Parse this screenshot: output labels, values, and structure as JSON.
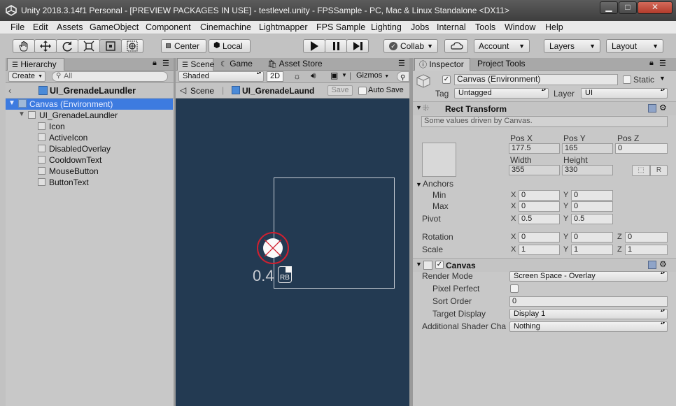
{
  "window": {
    "title": "Unity 2018.3.14f1 Personal - [PREVIEW PACKAGES IN USE] - testlevel.unity - FPSSample - PC, Mac & Linux Standalone <DX11>",
    "minimize": "▁",
    "maximize": "□",
    "close": "✕"
  },
  "menu": [
    "File",
    "Edit",
    "Assets",
    "GameObject",
    "Component",
    "Cinemachine",
    "Lightmapper",
    "FPS Sample",
    "Lighting",
    "Jobs",
    "Internal",
    "Tools",
    "Window",
    "Help"
  ],
  "toolbar": {
    "tools": [
      "hand-tool",
      "move-tool",
      "rotate-tool",
      "scale-tool",
      "rect-tool",
      "transform-tool"
    ],
    "pivot": "Center",
    "space": "Local",
    "collab": "Collab",
    "account": "Account",
    "layers": "Layers",
    "layout": "Layout"
  },
  "hierarchy": {
    "tab": "Hierarchy",
    "create": "Create",
    "search_placeholder": "All",
    "breadcrumb": "UI_GrenadeLaundler",
    "items": [
      {
        "label": "Canvas (Environment)",
        "depth": 0,
        "selected": true
      },
      {
        "label": "UI_GrenadeLaundler",
        "depth": 1
      },
      {
        "label": "Icon",
        "depth": 2
      },
      {
        "label": "ActiveIcon",
        "depth": 2
      },
      {
        "label": "DisabledOverlay",
        "depth": 2
      },
      {
        "label": "CooldownText",
        "depth": 2
      },
      {
        "label": "MouseButton",
        "depth": 2
      },
      {
        "label": "ButtonText",
        "depth": 2
      }
    ]
  },
  "scene": {
    "tabs": [
      "Scene",
      "Game",
      "Asset Store"
    ],
    "shading": "Shaded",
    "mode2d": "2D",
    "gizmos": "Gizmos",
    "breadcrumb_root": "Scene",
    "breadcrumb_prefab": "UI_GrenadeLaund",
    "save": "Save",
    "autosave": "Auto Save",
    "cooldown_text": "0.4",
    "button_text": "RB",
    "bg_color": "#233a52"
  },
  "inspector": {
    "tabs": [
      "Inspector",
      "Project Tools"
    ],
    "object_name": "Canvas (Environment)",
    "static": "Static",
    "tag_label": "Tag",
    "tag": "Untagged",
    "layer_label": "Layer",
    "layer": "UI",
    "rect": {
      "title": "Rect Transform",
      "note": "Some values driven by Canvas.",
      "posx_label": "Pos X",
      "posx": "177.5",
      "posy_label": "Pos Y",
      "posy": "165",
      "posz_label": "Pos Z",
      "posz": "0",
      "width_label": "Width",
      "width": "355",
      "height_label": "Height",
      "height": "330",
      "r": "R",
      "anchors": "Anchors",
      "min": "Min",
      "min_x": "0",
      "min_y": "0",
      "max": "Max",
      "max_x": "0",
      "max_y": "0",
      "pivot": "Pivot",
      "pivot_x": "0.5",
      "pivot_y": "0.5",
      "rotation": "Rotation",
      "rot_x": "0",
      "rot_y": "0",
      "rot_z": "0",
      "scale": "Scale",
      "scale_x": "1",
      "scale_y": "1",
      "scale_z": "1",
      "x": "X",
      "y": "Y",
      "z": "Z"
    },
    "canvas": {
      "title": "Canvas",
      "render_mode_label": "Render Mode",
      "render_mode": "Screen Space - Overlay",
      "pixel_perfect_label": "Pixel Perfect",
      "sort_order_label": "Sort Order",
      "sort_order": "0",
      "target_display_label": "Target Display",
      "target_display": "Display 1",
      "shader_label": "Additional Shader Cha",
      "shader": "Nothing"
    }
  }
}
